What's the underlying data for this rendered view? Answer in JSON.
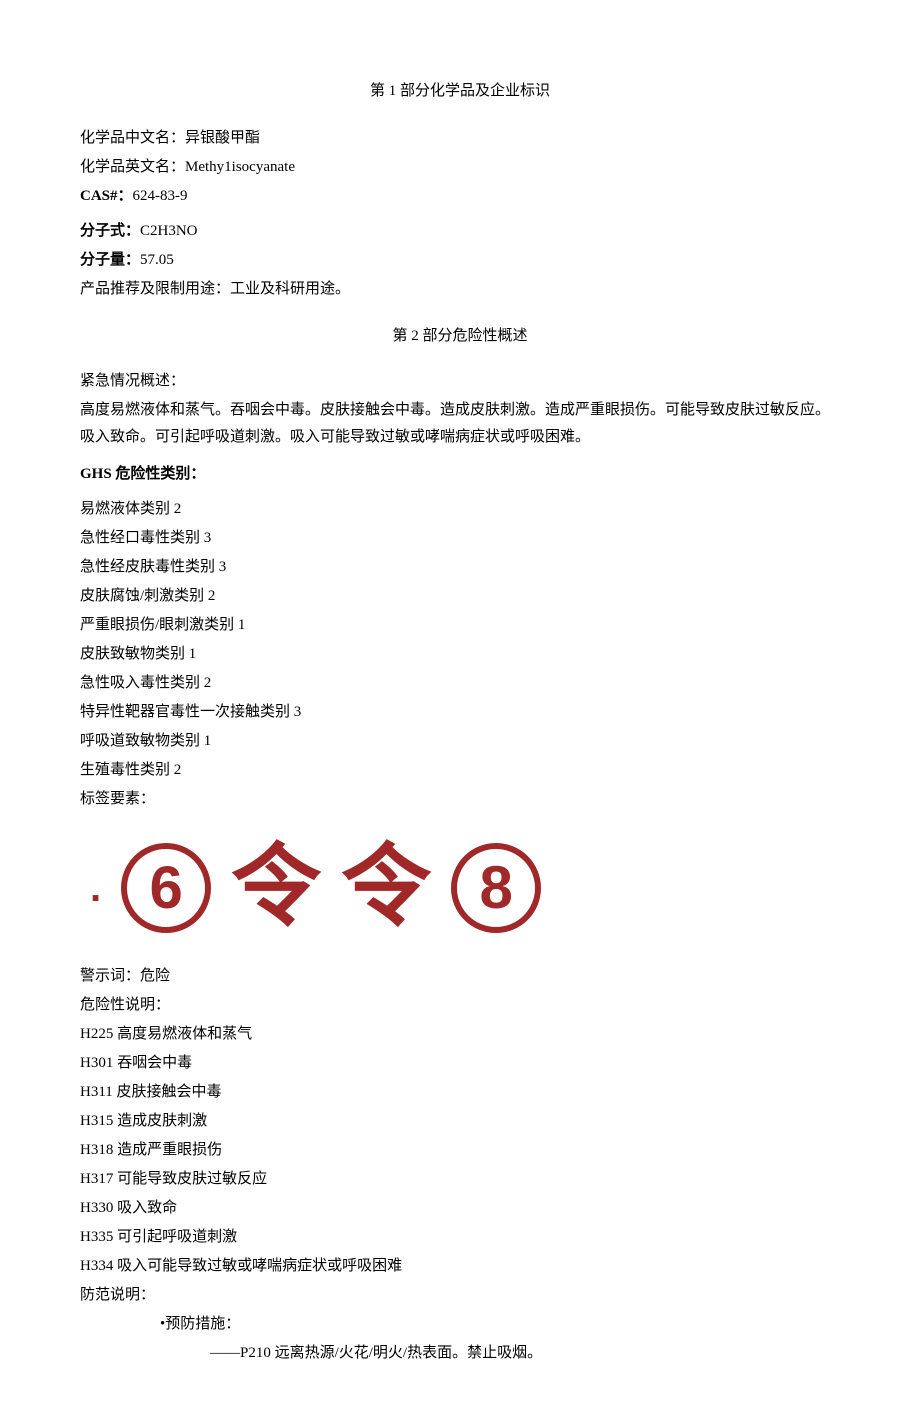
{
  "section1": {
    "title": "第 1 部分化学品及企业标识",
    "fields": {
      "chinese_name_label": "化学品中文名：",
      "chinese_name_value": "异银酸甲酯",
      "english_name_label": "化学品英文名：",
      "english_name_value": "Methy1isocyanate",
      "cas_label": "CAS#：",
      "cas_value": "624-83-9",
      "formula_label": "分子式：",
      "formula_value": "C2H3NO",
      "mw_label": "分子量：",
      "mw_value": "57.05",
      "use_label": "产品推荐及限制用途：",
      "use_value": "工业及科研用途。"
    }
  },
  "section2": {
    "title": "第 2 部分危险性概述",
    "emergency_label": "紧急情况概述：",
    "emergency_text": "高度易燃液体和蒸气。吞咽会中毒。皮肤接触会中毒。造成皮肤刺激。造成严重眼损伤。可能导致皮肤过敏反应。吸入致命。可引起呼吸道刺激。吸入可能导致过敏或哮喘病症状或呼吸困难。",
    "ghs_label": "GHS 危险性类别：",
    "ghs_classes": [
      "易燃液体类别 2",
      "急性经口毒性类别 3",
      "急性经皮肤毒性类别 3",
      "皮肤腐蚀/刺激类别 2",
      "严重眼损伤/眼刺激类别 1",
      "皮肤致敏物类别 1",
      "急性吸入毒性类别 2",
      "特异性靶器官毒性一次接触类别 3",
      "呼吸道致敏物类别 1",
      "生殖毒性类别 2"
    ],
    "label_elements": "标签要素：",
    "pictograms": {
      "p1": "6",
      "p2": "令",
      "p3": "令",
      "p4": "8"
    },
    "signal_label": "警示词：",
    "signal_value": "危险",
    "hazard_label": "危险性说明：",
    "hazard_statements": [
      "H225 高度易燃液体和蒸气",
      "H301 吞咽会中毒",
      "H311 皮肤接触会中毒",
      "H315 造成皮肤刺激",
      "H318 造成严重眼损伤",
      "H317 可能导致皮肤过敏反应",
      "H330 吸入致命",
      "H335 可引起呼吸道刺激",
      "H334 吸入可能导致过敏或哮喘病症状或呼吸困难"
    ],
    "precaution_label": "防范说明：",
    "prevention_label": "•预防措施：",
    "prevention_item": "——P210 远离热源/火花/明火/热表面。禁止吸烟。"
  }
}
